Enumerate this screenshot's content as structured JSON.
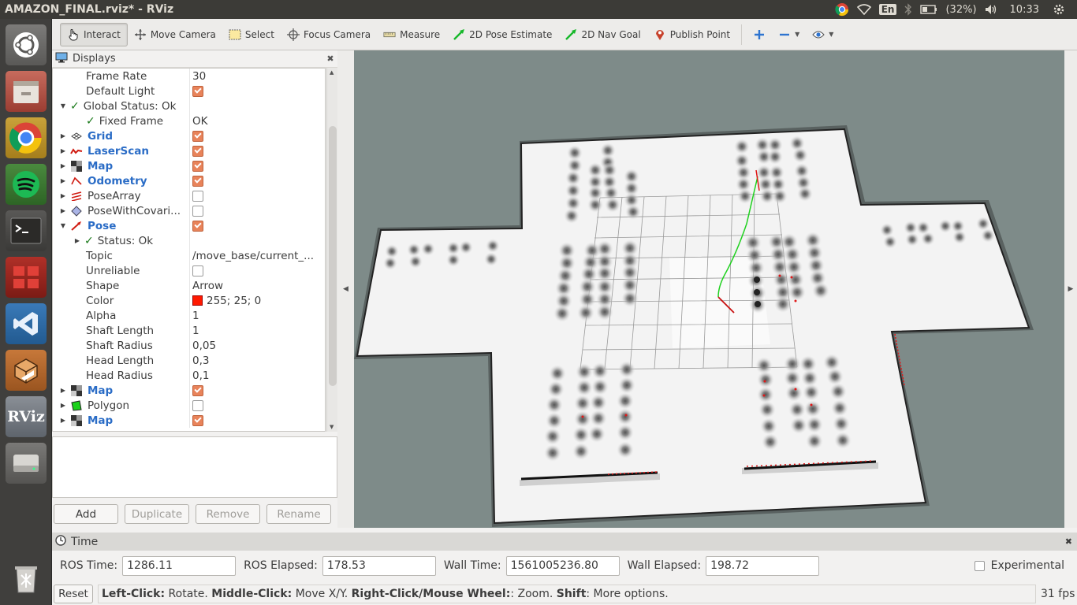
{
  "window_title": "AMAZON_FINAL.rviz* - RViz",
  "tray": {
    "keyboard_layout": "En",
    "battery_text": "(32%)",
    "clock": "10:33"
  },
  "launcher": {
    "items": [
      "dash-icon",
      "files-icon",
      "chrome-icon",
      "spotify-icon",
      "terminal-icon",
      "workspace-icon",
      "vscode-icon",
      "package-icon",
      "rviz-icon",
      "drive-icon",
      "trash-icon"
    ],
    "rviz_label": "RViz"
  },
  "toolbar": {
    "interact": "Interact",
    "move_camera": "Move Camera",
    "select": "Select",
    "focus_camera": "Focus Camera",
    "measure": "Measure",
    "pose_estimate": "2D Pose Estimate",
    "nav_goal": "2D Nav Goal",
    "publish_point": "Publish Point"
  },
  "displays": {
    "title": "Displays",
    "rows": [
      {
        "name": "Frame Rate",
        "value": "30"
      },
      {
        "name": "Default Light",
        "check": true
      },
      {
        "name": "Global Status: Ok"
      },
      {
        "name": "Fixed Frame",
        "value": "OK"
      },
      {
        "name": "Grid",
        "check": true
      },
      {
        "name": "LaserScan",
        "check": true
      },
      {
        "name": "Map",
        "check": true
      },
      {
        "name": "Odometry",
        "check": true
      },
      {
        "name": "PoseArray",
        "check": false
      },
      {
        "name": "PoseWithCovari...",
        "check": false
      },
      {
        "name": "Pose",
        "check": true
      },
      {
        "name": "Status: Ok"
      },
      {
        "name": "Topic",
        "value": "/move_base/current_..."
      },
      {
        "name": "Unreliable",
        "check": false
      },
      {
        "name": "Shape",
        "value": "Arrow"
      },
      {
        "name": "Color",
        "value": "255; 25; 0",
        "color": "#ff1900"
      },
      {
        "name": "Alpha",
        "value": "1"
      },
      {
        "name": "Shaft Length",
        "value": "1"
      },
      {
        "name": "Shaft Radius",
        "value": "0,05"
      },
      {
        "name": "Head Length",
        "value": "0,3"
      },
      {
        "name": "Head Radius",
        "value": "0,1"
      },
      {
        "name": "Map",
        "check": true
      },
      {
        "name": "Polygon",
        "check": false
      },
      {
        "name": "Map",
        "check": true
      }
    ]
  },
  "buttons": {
    "add": "Add",
    "duplicate": "Duplicate",
    "remove": "Remove",
    "rename": "Rename"
  },
  "time": {
    "title": "Time",
    "ros_time_label": "ROS Time:",
    "ros_time": "1286.11",
    "ros_elapsed_label": "ROS Elapsed:",
    "ros_elapsed": "178.53",
    "wall_time_label": "Wall Time:",
    "wall_time": "1561005236.80",
    "wall_elapsed_label": "Wall Elapsed:",
    "wall_elapsed": "198.72",
    "experimental_label": "Experimental"
  },
  "status": {
    "reset": "Reset",
    "left_click": "Left-Click:",
    "left_click_desc": " Rotate. ",
    "middle_click": "Middle-Click:",
    "middle_click_desc": " Move X/Y. ",
    "right_click": "Right-Click/Mouse Wheel:",
    "right_click_desc": ": Zoom. ",
    "shift": "Shift",
    "shift_desc": ": More options.",
    "fps": "31 fps"
  },
  "colors": {
    "accent_check": "#e8835a",
    "link_blue": "#2a6cc6",
    "viewport_bg": "#7e8b89",
    "topbar_bg": "#3c3b37"
  }
}
